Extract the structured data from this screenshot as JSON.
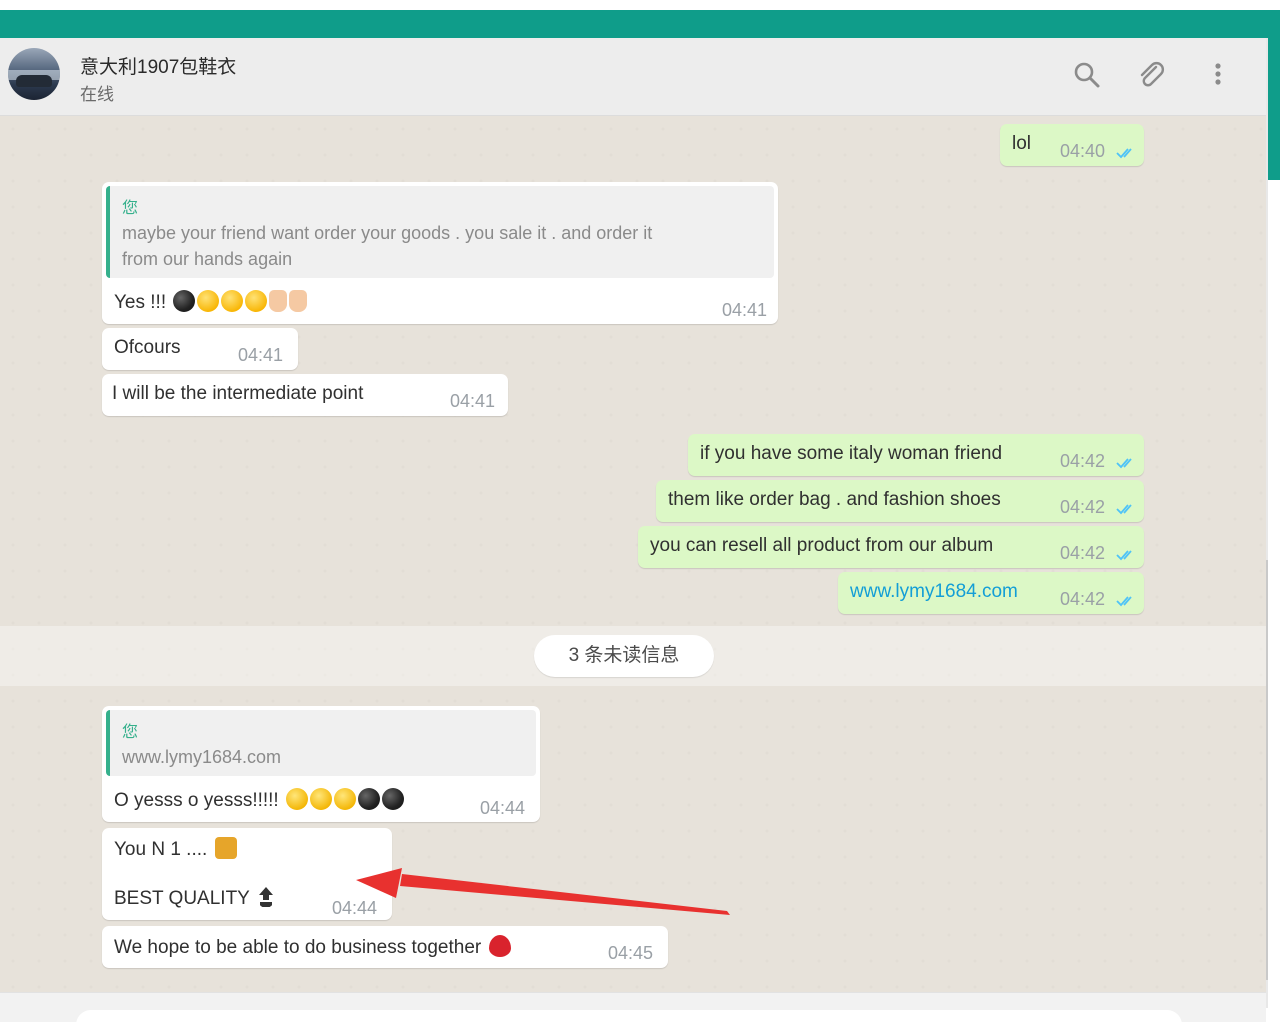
{
  "header": {
    "contact_name": "意大利1907包鞋衣",
    "contact_status": "在线"
  },
  "icons": {
    "search": "search-icon",
    "attach": "paperclip-icon",
    "menu": "kebab-menu-icon"
  },
  "messages": [
    {
      "id": "m1",
      "direction": "out",
      "text": "lol",
      "time": "04:40",
      "read": true
    },
    {
      "id": "m2",
      "direction": "in",
      "quote_author": "您",
      "quote_text": "maybe your friend want order your goods . you sale it . and order it\nfrom our hands again",
      "text": "Yes !!!",
      "emojis": [
        "bomb",
        "wink",
        "wink",
        "wink",
        "thumbs-up",
        "thumbs-up"
      ],
      "time": "04:41"
    },
    {
      "id": "m3",
      "direction": "in",
      "text": "Ofcours",
      "time": "04:41"
    },
    {
      "id": "m4",
      "direction": "in",
      "text": "I will be the intermediate point",
      "time": "04:41"
    },
    {
      "id": "m5",
      "direction": "out",
      "text": "if you have some italy woman friend",
      "time": "04:42",
      "read": true
    },
    {
      "id": "m6",
      "direction": "out",
      "text": "them like order bag . and fashion shoes",
      "time": "04:42",
      "read": true
    },
    {
      "id": "m7",
      "direction": "out",
      "text": "you can resell all product from our album",
      "time": "04:42",
      "read": true
    },
    {
      "id": "m8",
      "direction": "out",
      "text": "www.lymy1684.com",
      "is_link": true,
      "time": "04:42",
      "read": true
    },
    {
      "id": "m9",
      "direction": "in",
      "quote_author": "您",
      "quote_text": "www.lymy1684.com",
      "text": "O yesss o yesss!!!!!",
      "emojis": [
        "smile",
        "smile",
        "smile",
        "bomb",
        "bomb"
      ],
      "time": "04:44"
    },
    {
      "id": "m10",
      "direction": "in",
      "text": "You N 1 ....",
      "text2": "BEST QUALITY",
      "emojis": [
        "crown"
      ],
      "emojis2": [
        "top"
      ],
      "time": "04:44"
    },
    {
      "id": "m11",
      "direction": "in",
      "text": "We hope to be able to do business together",
      "emojis": [
        "heart"
      ],
      "time": "04:45"
    }
  ],
  "unread_divider": "3 条未读信息",
  "colors": {
    "accent": "#0f9d8a",
    "outgoing_bubble": "#dcf8c6",
    "incoming_bubble": "#ffffff",
    "quote_bar": "#35b08c",
    "link": "#139ed6",
    "read_tick": "#4fc3f7",
    "annotation_arrow": "#e8312f"
  }
}
